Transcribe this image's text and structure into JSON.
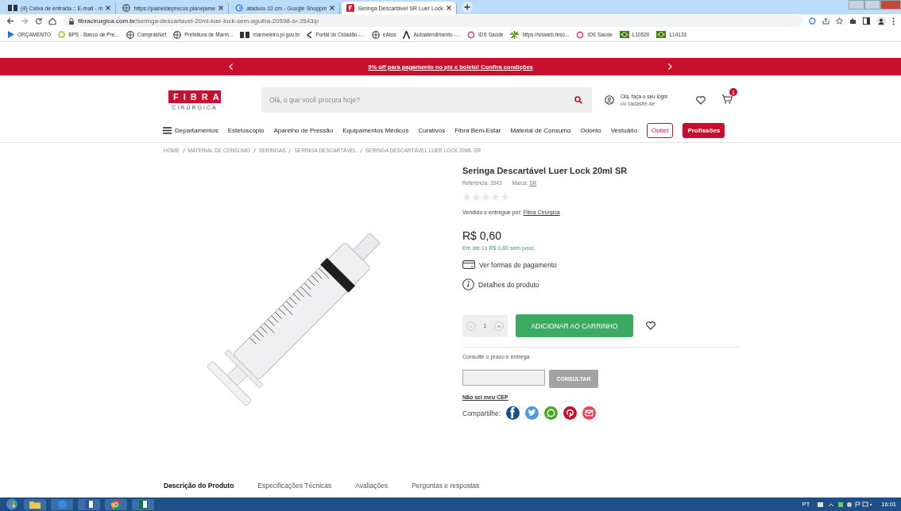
{
  "browser": {
    "tabs": [
      {
        "title": "(4) Caixa de entrada :: E-mail - m",
        "selected": false
      },
      {
        "title": "https://paineldeprecos.planejame",
        "selected": false
      },
      {
        "title": "atadura 10 cm - Google Shoppin",
        "selected": false
      },
      {
        "title": "Seringa Descartável SR Luer Lock",
        "selected": true
      }
    ],
    "url_host": "fibracirurgica.com.br",
    "url_path": "/seringa-descartavel-20ml-luer-lock-sem-agulha-20598-sr-3543/p",
    "bookmarks": [
      "ORÇAMENTO",
      "BPS - Banco de Pre...",
      "ComprasNet",
      "Prefeitura de Marm...",
      "marmeleiro.pr.gov.br",
      "Portal do Cidadão -...",
      "eAtos",
      "Autoatendimento -...",
      "IDS Saúde",
      "https://sisweb.teso...",
      "IDS Saúde",
      "L10520",
      "L14133"
    ]
  },
  "promo": {
    "text": "5% off para pagamento no pix e boleto! Confira condições"
  },
  "header": {
    "logo_top": "FIBRA",
    "logo_bottom": "CIRÚRGICA",
    "search": {
      "placeholder": "Olá, o que você procura hoje?"
    },
    "login_line1": "Olá, faça o seu login",
    "login_line2": "ou cadastre-se",
    "cart_count": "1"
  },
  "nav": [
    {
      "label": "Departamentos",
      "kind": "menu"
    },
    {
      "label": "Estetoscópio",
      "kind": "link"
    },
    {
      "label": "Aparelho de Pressão",
      "kind": "link"
    },
    {
      "label": "Equipamentos Médicos",
      "kind": "link"
    },
    {
      "label": "Curativos",
      "kind": "link"
    },
    {
      "label": "Fibra Bem-Estar",
      "kind": "link"
    },
    {
      "label": "Material de Consumo",
      "kind": "link"
    },
    {
      "label": "Odonto",
      "kind": "link"
    },
    {
      "label": "Vestuário",
      "kind": "link"
    },
    {
      "label": "Outlet",
      "kind": "outline"
    },
    {
      "label": "Profissões",
      "kind": "filled"
    }
  ],
  "breadcrumb": [
    "HOME",
    "MATERIAL DE CONSUMO",
    "SERINGAS",
    "SERINGA DESCARTÁVEL",
    "SERINGA DESCARTÁVEL LUER LOCK 20ML SR"
  ],
  "product": {
    "title": "Seringa Descartável Luer Lock 20ml SR",
    "reference_label": "Referência: 3543",
    "brand_label": "Marca:",
    "brand": "SR",
    "stars": 0,
    "seller_label": "Vendido e entregue por:",
    "seller": "Fibra Cirúrgica",
    "price": "R$ 0,60",
    "installments": "Em até 1x R$ 0,60 sem juros",
    "payment_link": "Ver formas de pagamento",
    "details_link": "Detalhes do produto",
    "quantity": "1",
    "qty_minus": "-",
    "qty_plus": "+",
    "add_button": "ADICIONAR AO CARRINHO",
    "shipping_label": "Consulte o prazo e entrega",
    "consult_button": "CONSULTAR",
    "cep_link": "Não sei meu CEP",
    "share_label": "Compartilhe:",
    "share": [
      {
        "kind": "facebook",
        "color": "#1d4c91"
      },
      {
        "kind": "twitter",
        "color": "#4a9be6"
      },
      {
        "kind": "whatsapp",
        "color": "#49a823"
      },
      {
        "kind": "pinterest",
        "color": "#c8102e"
      },
      {
        "kind": "email",
        "color": "#f0405a"
      }
    ]
  },
  "product_tabs": [
    {
      "label": "Descrição do Produto",
      "selected": true
    },
    {
      "label": "Especificações Técnicas",
      "selected": false
    },
    {
      "label": "Avaliações",
      "selected": false
    },
    {
      "label": "Perguntas e respostas",
      "selected": false
    }
  ],
  "taskbar": {
    "language": "PT",
    "time": "16:01"
  }
}
